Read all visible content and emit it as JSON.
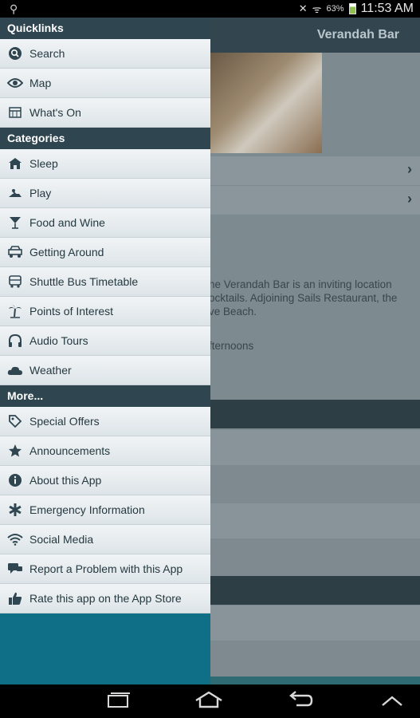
{
  "status_bar": {
    "usb_icon": "usb-icon",
    "mute_icon": "mute-icon",
    "wifi_icon": "wifi-icon",
    "battery_percent": "63%",
    "time": "11:53 AM"
  },
  "app": {
    "title": "Verandah Bar",
    "description_fragment": "he Verandah Bar is an inviting location\nocktails. Adjoining Sails Restaurant, the\nve Beach.",
    "hours_fragment": "fternoons"
  },
  "drawer": {
    "quicklinks_header": "Quicklinks",
    "quicklinks": [
      {
        "label": "Search",
        "icon": "search-icon"
      },
      {
        "label": "Map",
        "icon": "eye-icon"
      },
      {
        "label": "What's On",
        "icon": "calendar-icon"
      }
    ],
    "categories_header": "Categories",
    "categories": [
      {
        "label": "Sleep",
        "icon": "house-icon"
      },
      {
        "label": "Play",
        "icon": "jetski-icon"
      },
      {
        "label": "Food and Wine",
        "icon": "cocktail-icon"
      },
      {
        "label": "Getting Around",
        "icon": "cart-icon"
      },
      {
        "label": "Shuttle Bus Timetable",
        "icon": "bus-icon"
      },
      {
        "label": "Points of Interest",
        "icon": "palm-icon"
      },
      {
        "label": "Audio Tours",
        "icon": "headphones-icon"
      },
      {
        "label": "Weather",
        "icon": "cloud-icon"
      }
    ],
    "more_header": "More...",
    "more": [
      {
        "label": "Special Offers",
        "icon": "tag-icon"
      },
      {
        "label": "Announcements",
        "icon": "star-icon"
      },
      {
        "label": "About this App",
        "icon": "info-icon"
      },
      {
        "label": "Emergency Information",
        "icon": "medical-icon"
      },
      {
        "label": "Social Media",
        "icon": "wifi-icon"
      },
      {
        "label": "Report a Problem with this App",
        "icon": "chat-icon"
      },
      {
        "label": "Rate this app on the App Store",
        "icon": "thumbs-up-icon"
      }
    ]
  },
  "nav_bar": {
    "recent_icon": "recent-apps-icon",
    "home_icon": "home-icon",
    "back_icon": "back-icon",
    "up_icon": "chevron-up-icon"
  }
}
